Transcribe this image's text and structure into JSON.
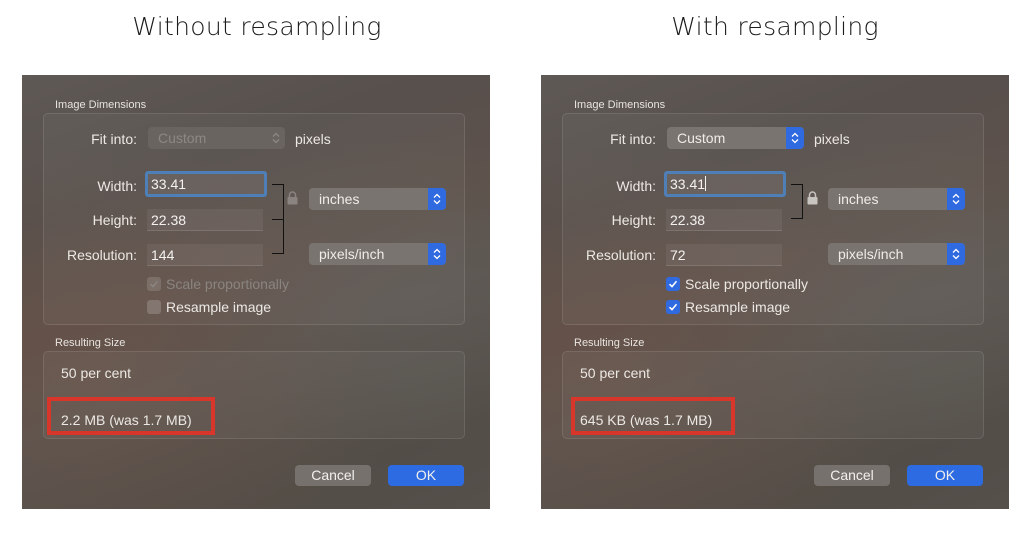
{
  "captions": {
    "left": "Without resampling",
    "right": "With resampling"
  },
  "panels": [
    {
      "id": "without",
      "image_dimensions_title": "Image Dimensions",
      "fit_into_label": "Fit into:",
      "fit_into_value": "Custom",
      "fit_into_enabled": false,
      "fit_into_unit": "pixels",
      "width_label": "Width:",
      "width_value": "33.41",
      "height_label": "Height:",
      "height_value": "22.38",
      "resolution_label": "Resolution:",
      "resolution_value": "144",
      "size_unit": "inches",
      "resolution_unit": "pixels/inch",
      "scale_label": "Scale proportionally",
      "scale_checked": true,
      "scale_enabled": false,
      "resample_label": "Resample image",
      "resample_checked": false,
      "resulting_size_title": "Resulting Size",
      "percent_text": "50 per cent",
      "size_text": "2.2 MB (was 1.7 MB)",
      "cancel_label": "Cancel",
      "ok_label": "OK"
    },
    {
      "id": "with",
      "image_dimensions_title": "Image Dimensions",
      "fit_into_label": "Fit into:",
      "fit_into_value": "Custom",
      "fit_into_enabled": true,
      "fit_into_unit": "pixels",
      "width_label": "Width:",
      "width_value": "33.41",
      "height_label": "Height:",
      "height_value": "22.38",
      "resolution_label": "Resolution:",
      "resolution_value": "72",
      "size_unit": "inches",
      "resolution_unit": "pixels/inch",
      "scale_label": "Scale proportionally",
      "scale_checked": true,
      "scale_enabled": true,
      "resample_label": "Resample image",
      "resample_checked": true,
      "resulting_size_title": "Resulting Size",
      "percent_text": "50 per cent",
      "size_text": "645 KB (was 1.7 MB)",
      "cancel_label": "Cancel",
      "ok_label": "OK"
    }
  ],
  "colors": {
    "accent_blue": "#2f6ae0",
    "highlight_red": "#d8362b",
    "focus_ring": "#4e7fb6"
  }
}
